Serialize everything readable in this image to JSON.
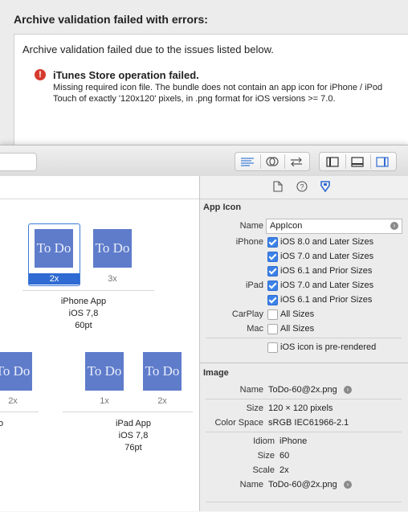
{
  "error_sheet": {
    "title": "Archive validation failed with errors:",
    "message": "Archive validation failed due to the issues listed below.",
    "issue_title": "iTunes Store operation failed.",
    "issue_detail_line1": "Missing required icon file. The bundle does not contain an app icon for iPhone / iPod",
    "issue_detail_line2": "Touch of exactly '120x120' pixels, in .png format for iOS versions >= 7.0.",
    "error_glyph": "!"
  },
  "toolbar": {
    "icons": [
      "standard-editor-icon",
      "assistant-editor-icon",
      "version-editor-icon",
      "navigator-toggle-icon",
      "debug-area-toggle-icon",
      "utilities-toggle-icon"
    ]
  },
  "canvas": {
    "tile_text": "To Do",
    "iphone": {
      "scales": [
        "2x",
        "3x"
      ],
      "label_line1": "iPhone App",
      "label_line2": "iOS 7,8",
      "label_line3": "60pt"
    },
    "ipad_left_scale": "2x",
    "ipad": {
      "scales": [
        "1x",
        "2x"
      ],
      "label_line1": "iPad App",
      "label_line2": "iOS 7,8",
      "label_line3": "76pt"
    },
    "cut_label": "o"
  },
  "inspector": {
    "tabs": [
      "file-inspector-icon",
      "quick-help-icon",
      "attributes-inspector-icon"
    ],
    "app_icon": {
      "section_title": "App Icon",
      "name_label": "Name",
      "name_value": "AppIcon",
      "iphone_label": "iPhone",
      "iphone_options": [
        {
          "label": "iOS 8.0 and Later Sizes",
          "checked": true
        },
        {
          "label": "iOS 7.0 and Later Sizes",
          "checked": true
        },
        {
          "label": "iOS 6.1 and Prior Sizes",
          "checked": true
        }
      ],
      "ipad_label": "iPad",
      "ipad_options": [
        {
          "label": "iOS 7.0 and Later Sizes",
          "checked": true
        },
        {
          "label": "iOS 6.1 and Prior Sizes",
          "checked": true
        }
      ],
      "carplay_label": "CarPlay",
      "carplay_option": "All Sizes",
      "mac_label": "Mac",
      "mac_option": "All Sizes",
      "prerendered_option": "iOS icon is pre-rendered"
    },
    "image": {
      "section_title": "Image",
      "name_label": "Name",
      "name_value": "ToDo-60@2x.png",
      "size_label": "Size",
      "size_value": "120 × 120 pixels",
      "colorspace_label": "Color Space",
      "colorspace_value": "sRGB IEC61966-2.1",
      "idiom_label": "Idiom",
      "idiom_value": "iPhone",
      "size2_label": "Size",
      "size2_value": "60",
      "scale_label": "Scale",
      "scale_value": "2x",
      "name2_label": "Name",
      "name2_value": "ToDo-60@2x.png"
    }
  },
  "colors": {
    "accent": "#2f6bd3",
    "tile": "#5f7ccb",
    "error": "#d63a2f"
  }
}
